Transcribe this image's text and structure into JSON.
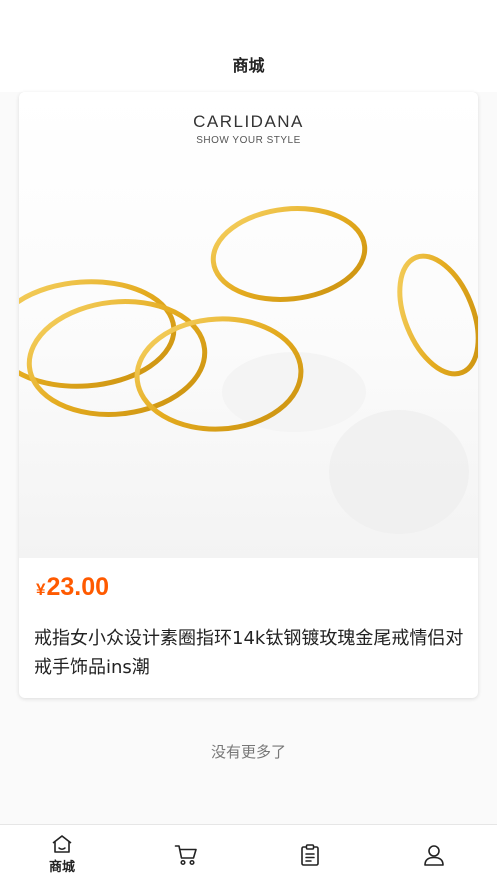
{
  "header": {
    "title": "商城"
  },
  "product": {
    "image": {
      "brand": "CARLIDANA",
      "slogan": "SHOW YOUR STYLE"
    },
    "currency_symbol": "¥",
    "price": "23.00",
    "title": "戒指女小众设计素圈指环14k钛钢镀玫瑰金尾戒情侣对戒手饰品ins潮"
  },
  "list_footer": "没有更多了",
  "tabbar": {
    "items": [
      {
        "label": "商城",
        "icon": "home-icon",
        "active": true
      },
      {
        "label": "",
        "icon": "cart-icon",
        "active": false
      },
      {
        "label": "",
        "icon": "orders-icon",
        "active": false
      },
      {
        "label": "",
        "icon": "user-icon",
        "active": false
      }
    ]
  },
  "colors": {
    "price": "#ff5a00",
    "gold": "#e8b322",
    "text": "#222222"
  }
}
